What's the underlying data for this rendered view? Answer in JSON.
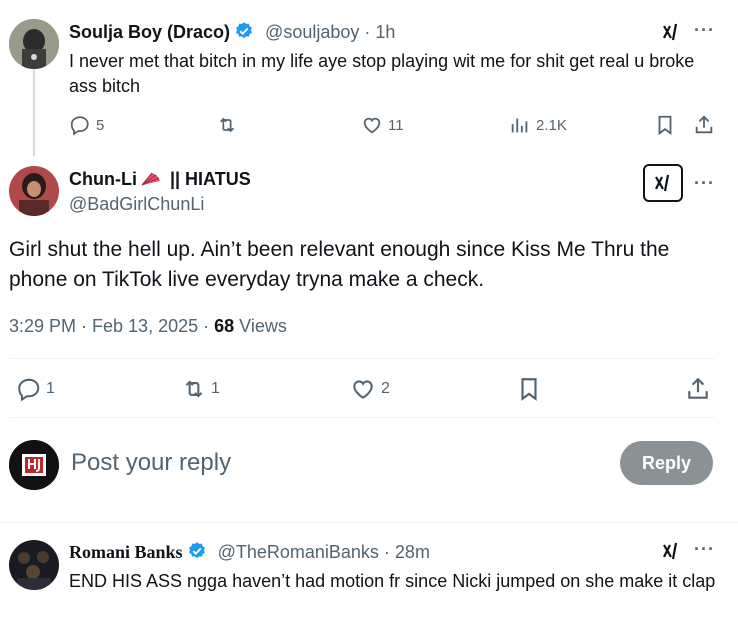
{
  "tweet1": {
    "display_name": "Soulja Boy (Draco)",
    "handle": "@souljaboy",
    "time": "· 1h",
    "text": "I never met that bitch in my life aye stop playing wit me for shit get real u broke ass bitch",
    "replies": "5",
    "retweets": "",
    "likes": "11",
    "views": "2.1K"
  },
  "main_tweet": {
    "display_name": "Chun-Li",
    "name_suffix": " || HIATUS",
    "handle": "@BadGirlChunLi",
    "text": "Girl shut the hell up. Ain’t been relevant enough since Kiss Me Thru the phone on TikTok live everyday tryna make a check.",
    "timestamp": "3:29 PM · Feb 13, 2025 · ",
    "views_count": "68",
    "views_label": " Views",
    "replies": "1",
    "retweets": "1",
    "likes": "2"
  },
  "reply_box": {
    "placeholder": "Post your reply",
    "button_label": "Reply"
  },
  "tweet3": {
    "display_name": "Romani Banks",
    "handle": "@TheRomaniBanks",
    "time": "· 28m",
    "text": "END HIS ASS ngga haven’t had motion fr since Nicki jumped on she make it clap"
  },
  "colors": {
    "verified": "#1d9bf0",
    "reply_button": "#8b9296",
    "muted": "#536471",
    "divider": "#eff3f4"
  }
}
